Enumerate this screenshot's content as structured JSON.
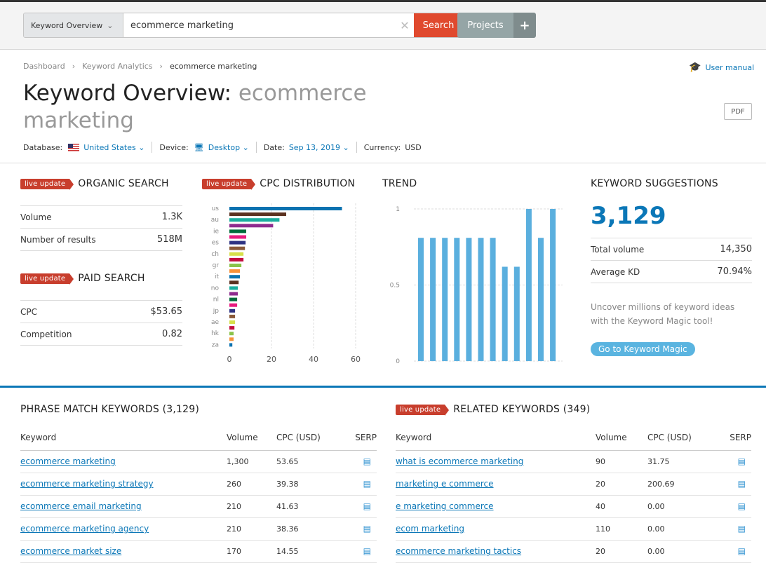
{
  "topbar": {
    "select_label": "Keyword Overview",
    "search_value": "ecommerce marketing",
    "search_button": "Search",
    "projects_label": "Projects",
    "add_label": "+"
  },
  "breadcrumb": [
    "Dashboard",
    "Keyword Analytics",
    "ecommerce marketing"
  ],
  "user_manual": "User manual",
  "title": {
    "prefix": "Keyword Overview:",
    "keyword": "ecommerce marketing"
  },
  "pdf": "PDF",
  "meta": {
    "database_label": "Database:",
    "database": "United States",
    "device_label": "Device:",
    "device": "Desktop",
    "date_label": "Date:",
    "date": "Sep 13, 2019",
    "currency_label": "Currency:",
    "currency": "USD"
  },
  "live_update": "live update",
  "organic": {
    "title": "ORGANIC SEARCH",
    "rows": [
      {
        "k": "Volume",
        "v": "1.3K"
      },
      {
        "k": "Number of results",
        "v": "518M"
      }
    ]
  },
  "paid": {
    "title": "PAID SEARCH",
    "rows": [
      {
        "k": "CPC",
        "v": "$53.65"
      },
      {
        "k": "Competition",
        "v": "0.82"
      }
    ]
  },
  "cpc_title": "CPC DISTRIBUTION",
  "trend_title": "TREND",
  "suggestions": {
    "title": "KEYWORD SUGGESTIONS",
    "count": "3,129",
    "rows": [
      {
        "k": "Total volume",
        "v": "14,350"
      },
      {
        "k": "Average KD",
        "v": "70.94%"
      }
    ],
    "note": "Uncover millions of keyword ideas with the Keyword Magic tool!",
    "button": "Go to Keyword Magic"
  },
  "chart_data": [
    {
      "type": "bar",
      "orientation": "horizontal",
      "title": "CPC DISTRIBUTION",
      "categories": [
        "us",
        "",
        "au",
        "",
        "ie",
        "",
        "es",
        "",
        "ch",
        "",
        "gr",
        "",
        "it",
        "",
        "no",
        "",
        "nl",
        "",
        "jp",
        "",
        "ae",
        "",
        "hk",
        "",
        "za"
      ],
      "values": [
        53.5,
        27,
        23.8,
        20.8,
        8,
        8,
        7.7,
        7.4,
        6.7,
        6.7,
        5.7,
        5,
        5,
        4.4,
        4,
        4,
        3.7,
        3.7,
        2.7,
        2.7,
        2.7,
        2.4,
        2,
        2,
        1.4
      ],
      "xlim": [
        0,
        60
      ],
      "xticks": [
        "0",
        "20",
        "40",
        "60"
      ],
      "grid": true,
      "colors": [
        "#0a72b0",
        "#5b3220",
        "#1aae9e",
        "#8e2b8e",
        "#006b3c",
        "#e8197e",
        "#2e3383",
        "#8a5a3a",
        "#d6e04a",
        "#c30c3e",
        "#8bc34a",
        "#f7923a"
      ]
    },
    {
      "type": "bar",
      "title": "TREND",
      "values": [
        0.81,
        0.81,
        0.81,
        0.81,
        0.81,
        0.81,
        0.81,
        0.62,
        0.62,
        1,
        0.81,
        1
      ],
      "ylim": [
        0,
        1
      ],
      "yticks": [
        "0",
        "0.5",
        "1"
      ],
      "grid": true,
      "color": "#5aafde"
    }
  ],
  "phrase": {
    "title": "PHRASE MATCH KEYWORDS (3,129)",
    "headers": [
      "Keyword",
      "Volume",
      "CPC (USD)",
      "SERP"
    ],
    "rows": [
      [
        "ecommerce marketing",
        "1,300",
        "53.65"
      ],
      [
        "ecommerce marketing strategy",
        "260",
        "39.38"
      ],
      [
        "ecommerce email marketing",
        "210",
        "41.63"
      ],
      [
        "ecommerce marketing agency",
        "210",
        "38.36"
      ],
      [
        "ecommerce market size",
        "170",
        "14.55"
      ]
    ]
  },
  "related": {
    "title": "RELATED KEYWORDS (349)",
    "headers": [
      "Keyword",
      "Volume",
      "CPC (USD)",
      "SERP"
    ],
    "rows": [
      [
        "what is ecommerce marketing",
        "90",
        "31.75"
      ],
      [
        "marketing e commerce",
        "20",
        "200.69"
      ],
      [
        "e marketing commerce",
        "40",
        "0.00"
      ],
      [
        "ecom marketing",
        "110",
        "0.00"
      ],
      [
        "ecommerce marketing tactics",
        "20",
        "0.00"
      ]
    ]
  }
}
